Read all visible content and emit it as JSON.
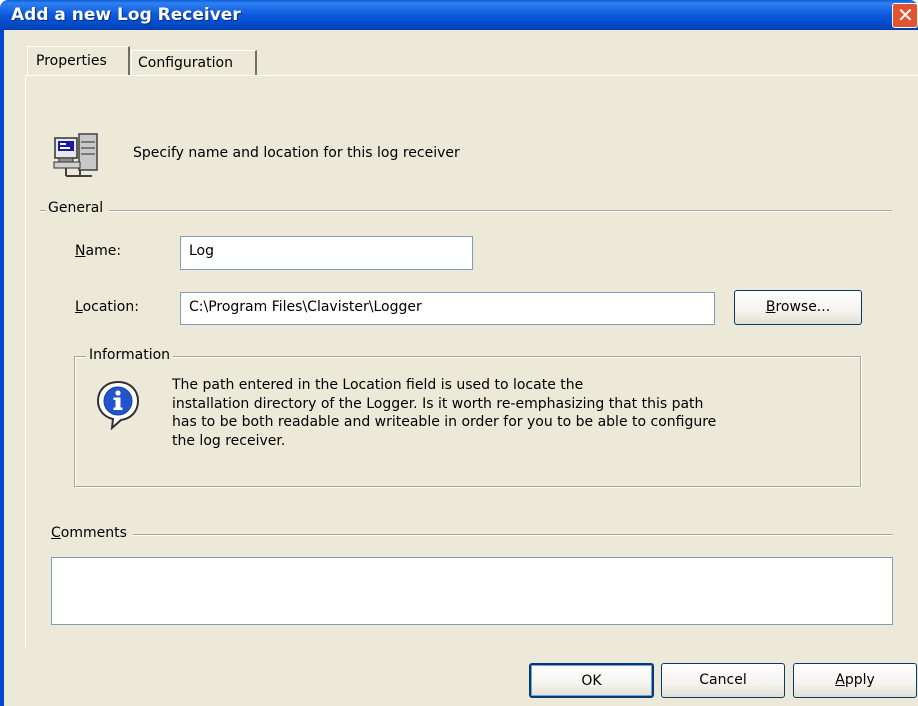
{
  "window": {
    "title": "Add a new Log Receiver"
  },
  "tabs": [
    {
      "label": "Properties",
      "active": true
    },
    {
      "label": "Configuration",
      "active": false
    }
  ],
  "header": {
    "text": "Specify name and location for this log receiver",
    "icon": "computer-network-icon"
  },
  "general": {
    "title": "General",
    "name": {
      "label_mnemonic": "N",
      "label_rest": "ame:",
      "value": "Log"
    },
    "location": {
      "label_mnemonic": "L",
      "label_rest": "ocation:",
      "value": "C:\\Program Files\\Clavister\\Logger"
    },
    "browse_mnemonic": "B",
    "browse_rest": "rowse..."
  },
  "information": {
    "title": "Information",
    "icon": "info-balloon-icon",
    "lines": [
      "The path entered in the Location field is used  to locate the",
      "installation directory of the Logger. Is it worth re-emphasizing that this path",
      "has to be both readable and writeable in order for you to be able to configure",
      "the log receiver."
    ]
  },
  "comments": {
    "label_mnemonic": "C",
    "label_rest": "omments",
    "value": ""
  },
  "buttons": {
    "ok": "OK",
    "cancel": "Cancel",
    "apply_mnemonic": "A",
    "apply_rest": "pply"
  },
  "colors": {
    "title_bar": "#0054e3",
    "dialog_face": "#ece9d8",
    "close_button": "#e2542f"
  }
}
